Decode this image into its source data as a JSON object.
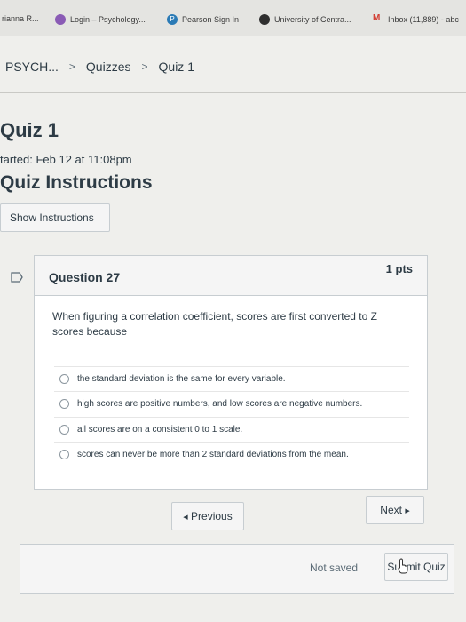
{
  "bookmarks": [
    {
      "label": "rianna R...",
      "icon": "none"
    },
    {
      "label": "Login – Psychology...",
      "icon": "chat-bubble-icon"
    },
    {
      "label": "Pearson Sign In",
      "icon": "pearson-icon"
    },
    {
      "label": "University of Centra...",
      "icon": "university-icon"
    },
    {
      "label": "Inbox (11,889) - abc",
      "icon": "gmail-icon"
    }
  ],
  "breadcrumb": {
    "course": "PSYCH...",
    "quizzes": "Quizzes",
    "quiz": "Quiz 1"
  },
  "quiz": {
    "title": "Quiz 1",
    "started": "tarted: Feb 12 at 11:08pm",
    "instructions_heading": "Quiz Instructions",
    "show_instructions_label": "Show Instructions"
  },
  "question": {
    "label": "Question 27",
    "points": "1 pts",
    "text": "When figuring a correlation coefficient, scores are first converted to Z scores because",
    "answers": [
      "the standard deviation is the same for every variable.",
      "high scores are positive numbers, and low scores are negative numbers.",
      "all scores are on a consistent 0 to 1 scale.",
      "scores can never be more than 2 standard deviations from the mean."
    ]
  },
  "nav": {
    "previous": "Previous",
    "next": "Next",
    "prev_arrow": "◀",
    "next_arrow": "▶"
  },
  "footer": {
    "status": "Not saved",
    "submit": "Submit Quiz"
  },
  "colors": {
    "accent": "#2d3b45",
    "background": "#efefec",
    "gmail": "#d23b30"
  }
}
